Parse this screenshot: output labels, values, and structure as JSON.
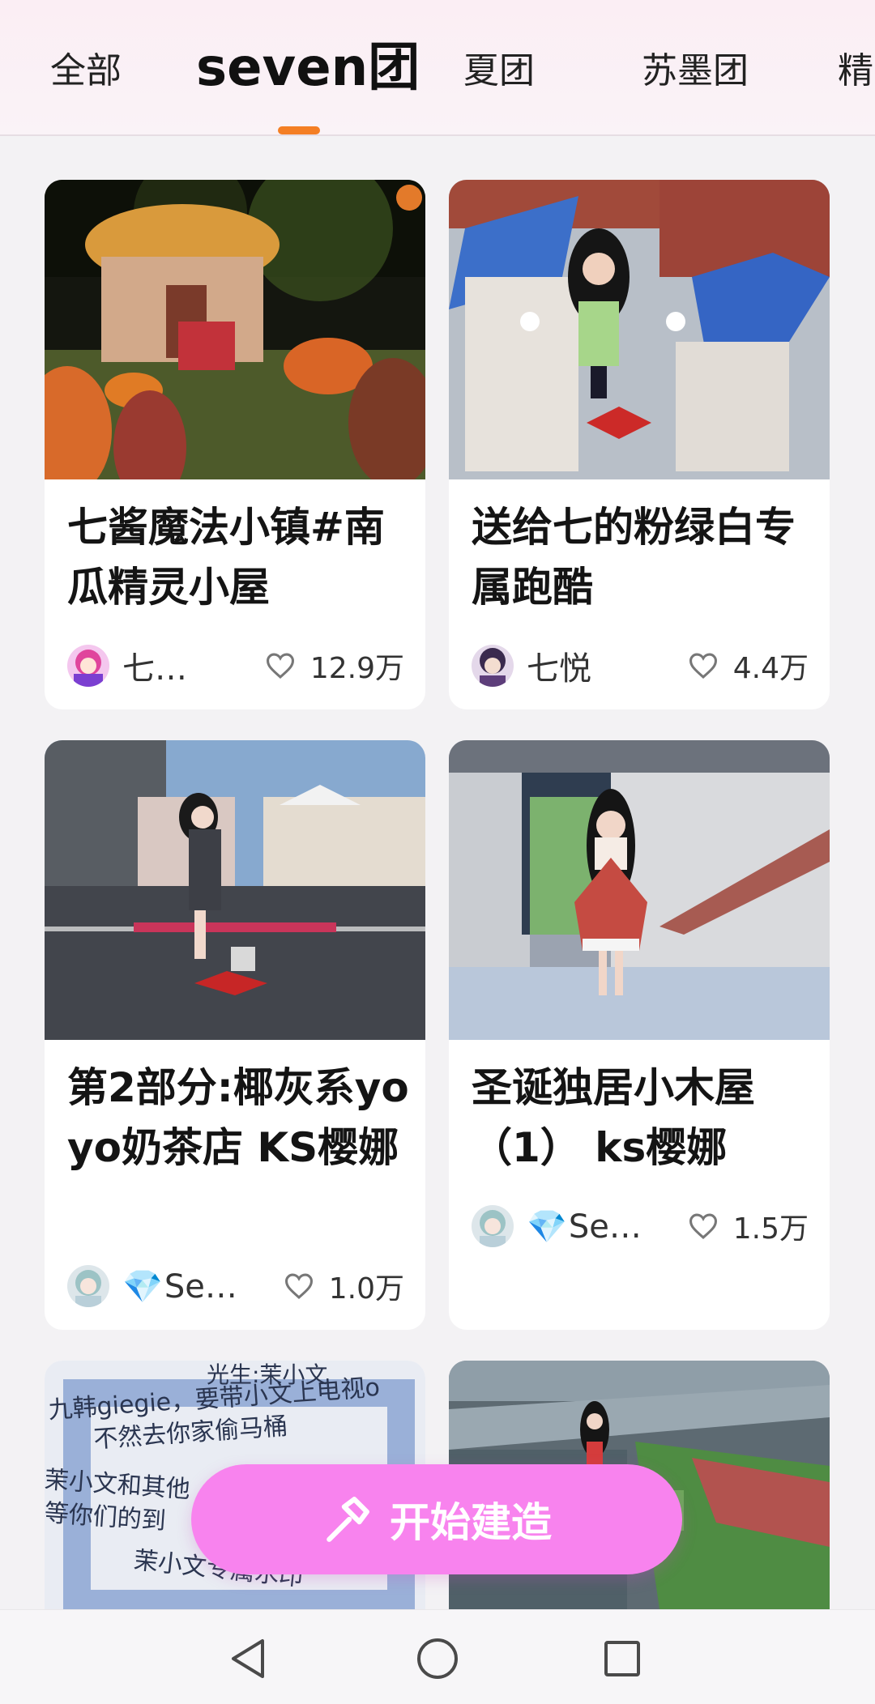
{
  "tabs": [
    {
      "label": "全部"
    },
    {
      "label": "seven团",
      "active": true
    },
    {
      "label": "夏团"
    },
    {
      "label": "苏墨团"
    },
    {
      "label": "精"
    }
  ],
  "cards": [
    {
      "title": "七酱魔法小镇#南瓜精灵小屋",
      "author": "七…",
      "likes": "12.9万",
      "thumb_icon": "pumpkin-house-scene"
    },
    {
      "title": "送给七的粉绿白专属跑酷",
      "author": "七悦",
      "likes": "4.4万",
      "thumb_icon": "parkour-rooftop-scene"
    },
    {
      "title": "第2部分:椰灰系yoyo奶茶店  KS樱娜",
      "author": "Se…",
      "author_prefix": "💎",
      "likes": "1.0万",
      "thumb_icon": "milk-tea-shop-street-scene"
    },
    {
      "title": "圣诞独居小木屋（1）  ks樱娜",
      "author": "Se…",
      "author_prefix": "💎",
      "likes": "1.5万",
      "thumb_icon": "wooden-cabin-interior-scene"
    }
  ],
  "partial_cards": [
    {
      "thumb_icon": "handwritten-note",
      "text_lines": [
        "九韩giegie，要带小文上电视o",
        "不然去你家偷马桶",
        "茉小文和其他",
        "等你们的到",
        "茉小文专属水印"
      ],
      "text_top": "光生:茉小文"
    },
    {
      "thumb_icon": "aerial-school-scene"
    }
  ],
  "build_button": {
    "label": "开始建造",
    "icon": "hammer-icon"
  },
  "navbar": {
    "back": "back-icon",
    "home": "home-icon",
    "recents": "recents-icon"
  },
  "colors": {
    "tab_indicator": "#f47f24",
    "build_button": "#f883ee",
    "card_bg": "#ffffff",
    "page_bg": "#f3f2f4"
  }
}
